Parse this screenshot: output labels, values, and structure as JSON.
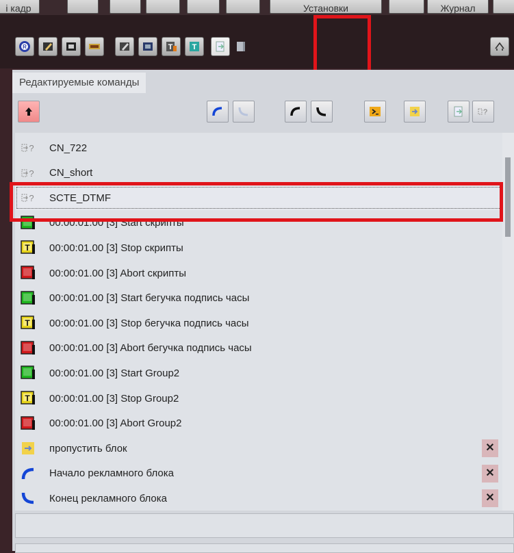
{
  "menubar": {
    "kadr_label": "і кадр",
    "ustanovki_label": "Установки",
    "zhurnal_label": "Журнал"
  },
  "toolbar": {
    "icons": [
      "r-circle-icon",
      "edit-icon",
      "film-icon",
      "clip-icon",
      "edit2-icon",
      "film2-icon",
      "text-icon",
      "text2-icon",
      "insert-command-icon",
      "page-icon",
      "network-icon"
    ]
  },
  "panel": {
    "tab_label": "Редактируемые команды",
    "list": [
      {
        "icon": "unknown-command-icon",
        "text": "CN_722",
        "close": false
      },
      {
        "icon": "unknown-command-icon",
        "text": "CN_short",
        "close": false
      },
      {
        "icon": "unknown-command-icon",
        "text": "SCTE_DTMF",
        "close": false,
        "selected": true
      },
      {
        "icon": "start-icon",
        "text": "00:00:01.00  [3] Start скрипты",
        "close": false
      },
      {
        "icon": "stop-icon",
        "text": "00:00:01.00  [3] Stop скрипты",
        "close": false
      },
      {
        "icon": "abort-icon",
        "text": "00:00:01.00  [3] Abort скрипты",
        "close": false
      },
      {
        "icon": "start-icon",
        "text": "00:00:01.00  [3] Start бегучка подпись часы",
        "close": false
      },
      {
        "icon": "stop-icon",
        "text": "00:00:01.00  [3] Stop бегучка подпись часы",
        "close": false
      },
      {
        "icon": "abort-icon",
        "text": "00:00:01.00  [3] Abort бегучка подпись часы",
        "close": false
      },
      {
        "icon": "start-icon",
        "text": "00:00:01.00  [3] Start Group2",
        "close": false
      },
      {
        "icon": "stop-icon",
        "text": "00:00:01.00  [3] Stop Group2",
        "close": false
      },
      {
        "icon": "abort-icon",
        "text": "00:00:01.00  [3] Abort Group2",
        "close": false
      },
      {
        "icon": "skip-block-icon",
        "text": "пропустить блок",
        "close": true
      },
      {
        "icon": "ad-block-start-icon",
        "text": "Начало рекламного блока",
        "close": true
      },
      {
        "icon": "ad-block-end-icon",
        "text": "Конец рекламного блока",
        "close": true
      }
    ],
    "close_glyph": "✕"
  },
  "colors": {
    "highlight": "#e0141a",
    "panel_bg": "#d3d6dc",
    "list_bg": "#dfe2e7",
    "start": "#1fb51f",
    "stop": "#e6d31a",
    "abort": "#d0191c",
    "blue": "#1446d6"
  }
}
